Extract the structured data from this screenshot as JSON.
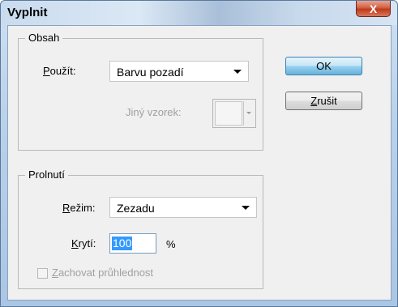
{
  "window": {
    "title": "Vyplnit",
    "close_glyph": "X"
  },
  "content_group": {
    "title": "Obsah",
    "use_label_underlined": "P",
    "use_label_rest": "oužít:",
    "use_value": "Barvu pozadí",
    "pattern_label": "Jiný vzorek:"
  },
  "blend_group": {
    "title": "Prolnutí",
    "mode_label_underlined": "R",
    "mode_label_rest": "ežim:",
    "mode_value": "Zezadu",
    "opacity_label_underlined": "K",
    "opacity_label_rest": "rytí:",
    "opacity_value": "100",
    "opacity_unit": "%",
    "preserve_label_underlined": "Z",
    "preserve_label_rest": "achovat průhlednost",
    "preserve_checked": false
  },
  "buttons": {
    "ok": "OK",
    "cancel_underlined": "Z",
    "cancel_rest": "rušit"
  }
}
